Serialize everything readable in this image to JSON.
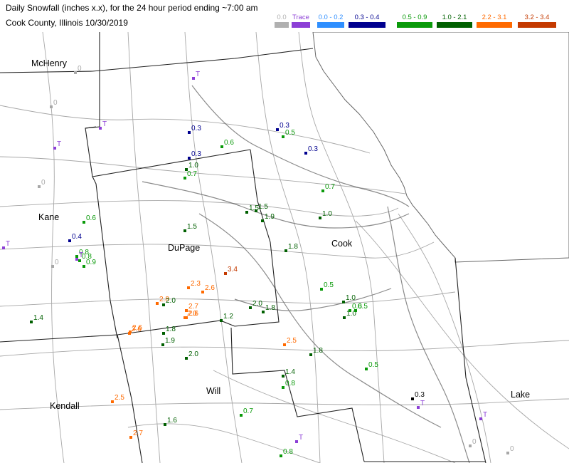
{
  "title_line1": "Daily Snowfall (inches  x.x),  for the 24 hour period ending ~7:00 am",
  "title_line2": "Cook County, Illinois  10/30/2019",
  "legend": [
    {
      "label": "0.0",
      "color": "#b0b0b0"
    },
    {
      "label": "Trace",
      "color": "#8c3fd6"
    },
    {
      "label": "0.0 - 0.2",
      "color": "#2f8fff"
    },
    {
      "label": "0.3 - 0.4",
      "color": "#00008f"
    },
    {
      "label": "0.5 - 0.9",
      "color": "#0a9a0a"
    },
    {
      "label": "1.0 - 2.1",
      "color": "#006000"
    },
    {
      "label": "2.2 - 3.1",
      "color": "#ff6a00"
    },
    {
      "label": "3.2 - 3.4",
      "color": "#c43a00"
    }
  ],
  "places": [
    "McHenry",
    "Kane",
    "DuPage",
    "Cook",
    "Will",
    "Kendall",
    "Lake"
  ],
  "observations": [
    {
      "label": "0",
      "cat": 0
    },
    {
      "label": "T",
      "cat": 1
    },
    {
      "label": "T",
      "cat": 1
    },
    {
      "label": "T",
      "cat": 1
    },
    {
      "label": "0",
      "cat": 0
    },
    {
      "label": "0",
      "cat": 0
    },
    {
      "label": "T",
      "cat": 1
    },
    {
      "label": "0.3",
      "cat": 3
    },
    {
      "label": "0.6",
      "cat": 4
    },
    {
      "label": "0.3",
      "cat": 3
    },
    {
      "label": "1.0",
      "cat": 5
    },
    {
      "label": "0.7",
      "cat": 4
    },
    {
      "label": "0.3",
      "cat": 3
    },
    {
      "label": "0.5",
      "cat": 4
    },
    {
      "label": "0.3",
      "cat": 3
    },
    {
      "label": "0.7",
      "cat": 4
    },
    {
      "label": "1.5",
      "cat": 5
    },
    {
      "label": "1.5",
      "cat": 5
    },
    {
      "label": "1.9",
      "cat": 5
    },
    {
      "label": "1.0",
      "cat": 5
    },
    {
      "label": "0.6",
      "cat": 4
    },
    {
      "label": "0.4",
      "cat": 3
    },
    {
      "label": "0.8",
      "cat": 4
    },
    {
      "label": "0.8",
      "cat": 4
    },
    {
      "label": "0.9",
      "cat": 4
    },
    {
      "label": "1.5",
      "cat": 5
    },
    {
      "label": "1.8",
      "cat": 5
    },
    {
      "label": "0",
      "cat": 0
    },
    {
      "label": "T",
      "cat": 1
    },
    {
      "label": "3.4",
      "cat": 7
    },
    {
      "label": "2.3",
      "cat": 6
    },
    {
      "label": "2.6",
      "cat": 6
    },
    {
      "label": "2.8",
      "cat": 6
    },
    {
      "label": "2.0",
      "cat": 5
    },
    {
      "label": "2.7",
      "cat": 6
    },
    {
      "label": "2.6",
      "cat": 6
    },
    {
      "label": "2.0",
      "cat": 6
    },
    {
      "label": "0.5",
      "cat": 4
    },
    {
      "label": "1.0",
      "cat": 5
    },
    {
      "label": "0.6",
      "cat": 4
    },
    {
      "label": "1.0",
      "cat": 5
    },
    {
      "label": "0.5",
      "cat": 4
    },
    {
      "label": "2.0",
      "cat": 5
    },
    {
      "label": "1.8",
      "cat": 5
    },
    {
      "label": "1.2",
      "cat": 5
    },
    {
      "label": "1.4",
      "cat": 5
    },
    {
      "label": "2.6",
      "cat": 6
    },
    {
      "label": "1.8",
      "cat": 5
    },
    {
      "label": "1.9",
      "cat": 5
    },
    {
      "label": "2.0",
      "cat": 5
    },
    {
      "label": "2.6",
      "cat": 6
    },
    {
      "label": "2.5",
      "cat": 6
    },
    {
      "label": "1.8",
      "cat": 5
    },
    {
      "label": "0.5",
      "cat": 4
    },
    {
      "label": "1.4",
      "cat": 5
    },
    {
      "label": "0.8",
      "cat": 4
    },
    {
      "label": "0.3",
      "cat": 8
    },
    {
      "label": "T",
      "cat": 1
    },
    {
      "label": "T",
      "cat": 1
    },
    {
      "label": "2.5",
      "cat": 6
    },
    {
      "label": "1.6",
      "cat": 5
    },
    {
      "label": "0.7",
      "cat": 4
    },
    {
      "label": "2.7",
      "cat": 6
    },
    {
      "label": "T",
      "cat": 1
    },
    {
      "label": "0.8",
      "cat": 4
    },
    {
      "label": "0",
      "cat": 0
    },
    {
      "label": "0",
      "cat": 0
    }
  ]
}
